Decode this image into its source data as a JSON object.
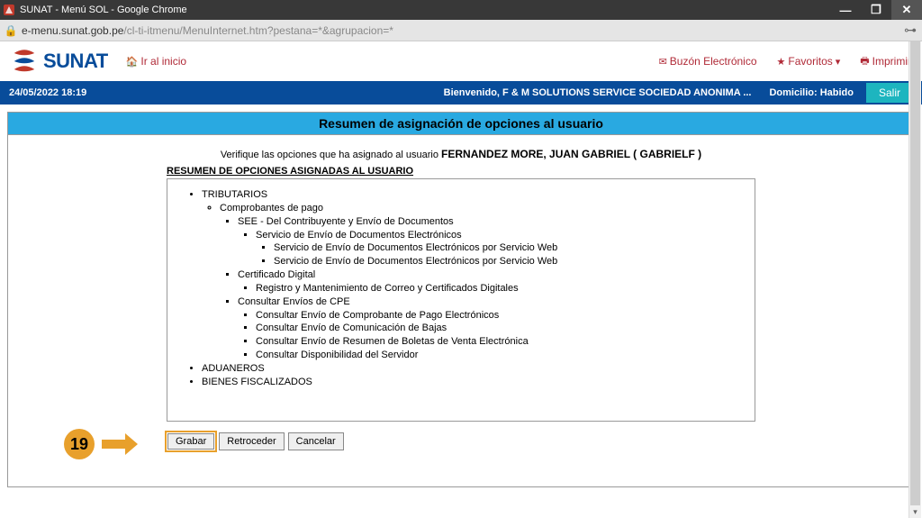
{
  "os": {
    "title": "SUNAT - Menú SOL - Google Chrome",
    "min": "—",
    "max": "❐",
    "close": "✕"
  },
  "url": {
    "host": "e-menu.sunat.gob.pe",
    "path": "/cl-ti-itmenu/MenuInternet.htm?pestana=*&agrupacion=*"
  },
  "header": {
    "brand": "SUNAT",
    "home": "Ir al inicio",
    "mailbox": "Buzón Electrónico",
    "favorites": "Favoritos",
    "print": "Imprimir"
  },
  "status": {
    "datetime": "24/05/2022 18:19",
    "welcome": "Bienvenido, F & M SOLUTIONS SERVICE SOCIEDAD ANONIMA ...",
    "domicilio": "Domicilio: Habido",
    "salir": "Salir"
  },
  "page": {
    "title": "Resumen de asignación de opciones al usuario",
    "verify_prefix": "Verifique las opciones que ha asignado al usuario ",
    "user": "FERNANDEZ MORE, JUAN GABRIEL ( GABRIELF )",
    "box_title": "RESUMEN DE OPCIONES ASIGNADAS AL USUARIO"
  },
  "tree": {
    "tributarios": "TRIBUTARIOS",
    "comprobantes": "Comprobantes de pago",
    "see": "SEE - Del Contribuyente y Envío de Documentos",
    "servicio_envio": "Servicio de Envío de Documentos Electrónicos",
    "servicio_web1": "Servicio de Envío de Documentos Electrónicos por Servicio Web",
    "servicio_web2": "Servicio de Envío de Documentos Electrónicos por Servicio Web",
    "cert_digital": "Certificado Digital",
    "registro_cert": "Registro y Mantenimiento de Correo y Certificados Digitales",
    "consultar_cpe": "Consultar Envíos de CPE",
    "cpe1": "Consultar Envío de Comprobante de Pago Electrónicos",
    "cpe2": "Consultar Envío de Comunicación de Bajas",
    "cpe3": "Consultar Envío de Resumen de Boletas de Venta Electrónica",
    "cpe4": "Consultar Disponibilidad del Servidor",
    "aduaneros": "ADUANEROS",
    "bienes": "BIENES FISCALIZADOS"
  },
  "buttons": {
    "grabar": "Grabar",
    "retroceder": "Retroceder",
    "cancelar": "Cancelar"
  },
  "annotation": {
    "number": "19"
  }
}
